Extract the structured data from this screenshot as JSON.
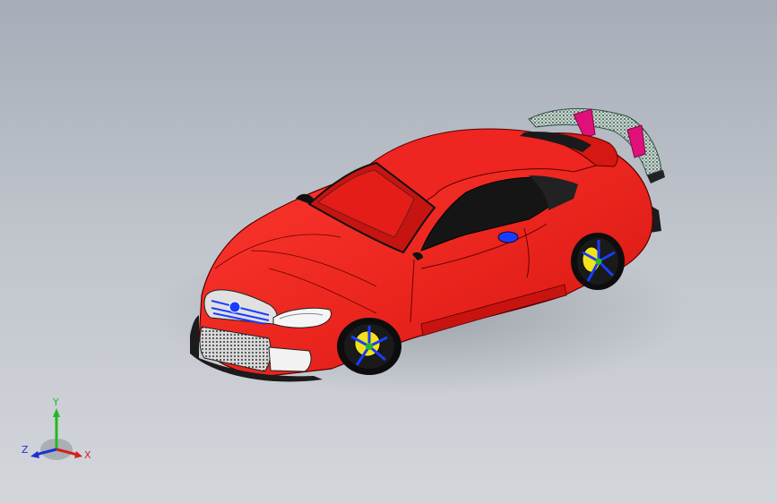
{
  "viewport": {
    "background_top": "#a6adb8",
    "background_bottom": "#d3d6db"
  },
  "model": {
    "body_color": "#e8201c",
    "glass_color": "#111111",
    "wheel_accent": "#1a3cff",
    "caliper_color": "#f2e21a",
    "wing_pattern_color": "#8fb8a4"
  },
  "triad": {
    "x_label": "X",
    "y_label": "Y",
    "z_label": "Z",
    "x_color": "#d42020",
    "y_color": "#22b822",
    "z_color": "#1d2fd8"
  }
}
